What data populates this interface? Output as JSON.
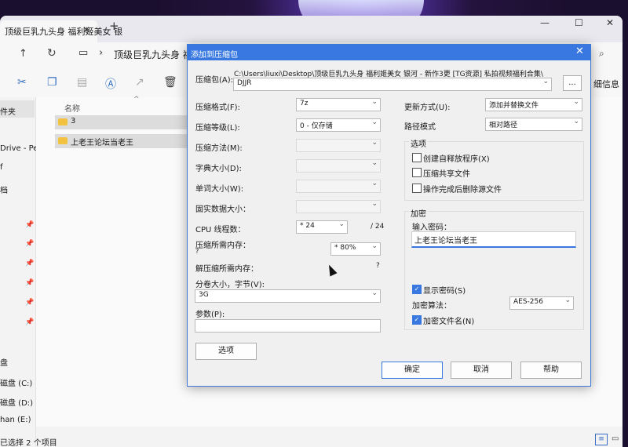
{
  "explorer": {
    "tab_title": "顶级巨乳九头身 福利姬美女 银",
    "tab_close": "✕",
    "tab_new": "+",
    "win_min": "—",
    "win_max": "☐",
    "win_close": "✕",
    "breadcrumb": "顶级巨乳九头身 福",
    "details_label": "细信息",
    "column_name": "名称",
    "files": [
      {
        "name": "3"
      },
      {
        "name": "上老王论坛当老王"
      }
    ],
    "nav_items": [
      "件夹",
      "Drive - Per",
      "f",
      "档",
      "磁盘 (C:)",
      "磁盘 (D:)",
      "han (E:)",
      "盘"
    ],
    "status_text": "已选择 2 个项目"
  },
  "dialog": {
    "title": "添加到压缩包",
    "close": "✕",
    "archive_label": "压缩包(A):",
    "archive_path": "C:\\Users\\liuxi\\Desktop\\顶级巨乳九头身 福利姬美女 银河 - 新作3更 [TG资源] 私拍视频福利合集\\",
    "archive_name": "DJJR",
    "browse_label": "...",
    "format_label": "压缩格式(F):",
    "format_value": "7z",
    "level_label": "压缩等级(L):",
    "level_value": "0 - 仅存储",
    "method_label": "压缩方法(M):",
    "dict_label": "字典大小(D):",
    "word_label": "单词大小(W):",
    "solid_label": "固实数据大小：",
    "cpu_label": "CPU 线程数：",
    "cpu_value": "* 24",
    "cpu_total": "/ 24",
    "mem_label": "压缩所需内存：",
    "mem_q": "?",
    "mem_value": "* 80%",
    "decomp_label": "解压缩所需内存：",
    "decomp_q": "?",
    "split_label": "分卷大小，字节(V):",
    "split_value": "3G",
    "params_label": "参数(P):",
    "options_button": "选项",
    "update_label": "更新方式(U):",
    "update_value": "添加并替换文件",
    "path_label": "路径模式",
    "path_value": "相对路径",
    "options_group": "选项",
    "opt_sfx": "创建自释放程序(X)",
    "opt_shared": "压缩共享文件",
    "opt_delete": "操作完成后删除源文件",
    "encrypt_group": "加密",
    "password_label": "输入密码：",
    "password_value": "上老王论坛当老王",
    "show_password": "显示密码(S)",
    "enc_method_label": "加密算法：",
    "enc_method_value": "AES-256",
    "encrypt_names": "加密文件名(N)",
    "ok": "确定",
    "cancel": "取消",
    "help": "帮助"
  }
}
